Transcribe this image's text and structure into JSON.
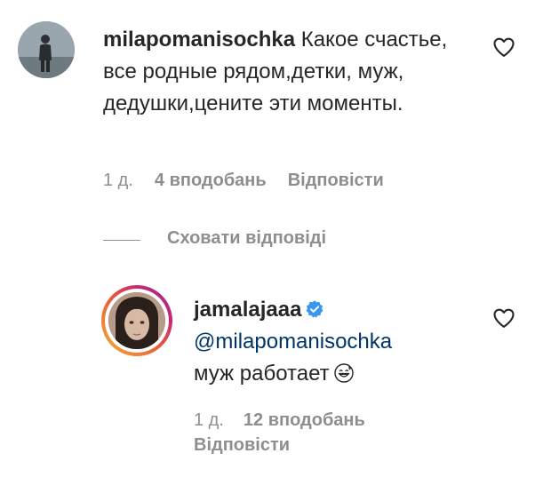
{
  "comment": {
    "username": "milapomanisochka",
    "text": " Какое счастье, все родные рядом,детки, муж, дедушки,цените эти моменты.",
    "time": "1 д.",
    "likes": "4 вподобань",
    "reply_label": "Відповісти",
    "like_icon": "heart-outline-icon",
    "liked": false
  },
  "thread": {
    "hide_replies_label": "Сховати відповіді"
  },
  "reply": {
    "username": "jamalajaaa",
    "verified": true,
    "mention": "@milapomanisochka",
    "text": "муж работает",
    "emoji": "grinning-sweat-emoji",
    "time": "1 д.",
    "likes": "12 вподобань",
    "reply_label": "Відповісти",
    "like_icon": "heart-outline-icon",
    "liked": false
  },
  "colors": {
    "text": "#262626",
    "muted": "#8e8e8e",
    "mention": "#003569",
    "verified": "#3897f0"
  }
}
